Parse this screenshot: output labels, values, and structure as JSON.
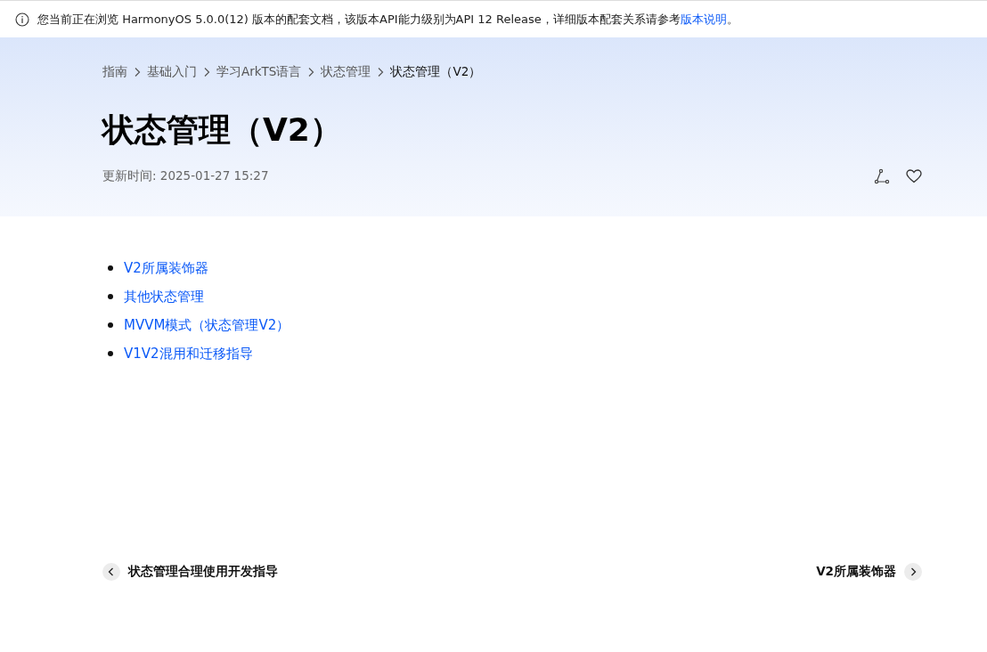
{
  "notice": {
    "text": "您当前正在浏览 HarmonyOS 5.0.0(12) 版本的配套文档，该版本API能力级别为API 12 Release，详细版本配套关系请参考",
    "link": "版本说明",
    "tail": "。"
  },
  "breadcrumb": [
    {
      "label": "指南",
      "current": false
    },
    {
      "label": "基础入门",
      "current": false
    },
    {
      "label": "学习ArkTS语言",
      "current": false
    },
    {
      "label": "状态管理",
      "current": false
    },
    {
      "label": "状态管理（V2）",
      "current": true
    }
  ],
  "title": "状态管理（V2）",
  "updated": "更新时间: 2025-01-27 15:27",
  "toc": [
    "V2所属装饰器",
    "其他状态管理",
    "MVVM模式（状态管理V2）",
    "V1V2混用和迁移指导"
  ],
  "pager": {
    "prev": "状态管理合理使用开发指导",
    "next": "V2所属装饰器"
  }
}
